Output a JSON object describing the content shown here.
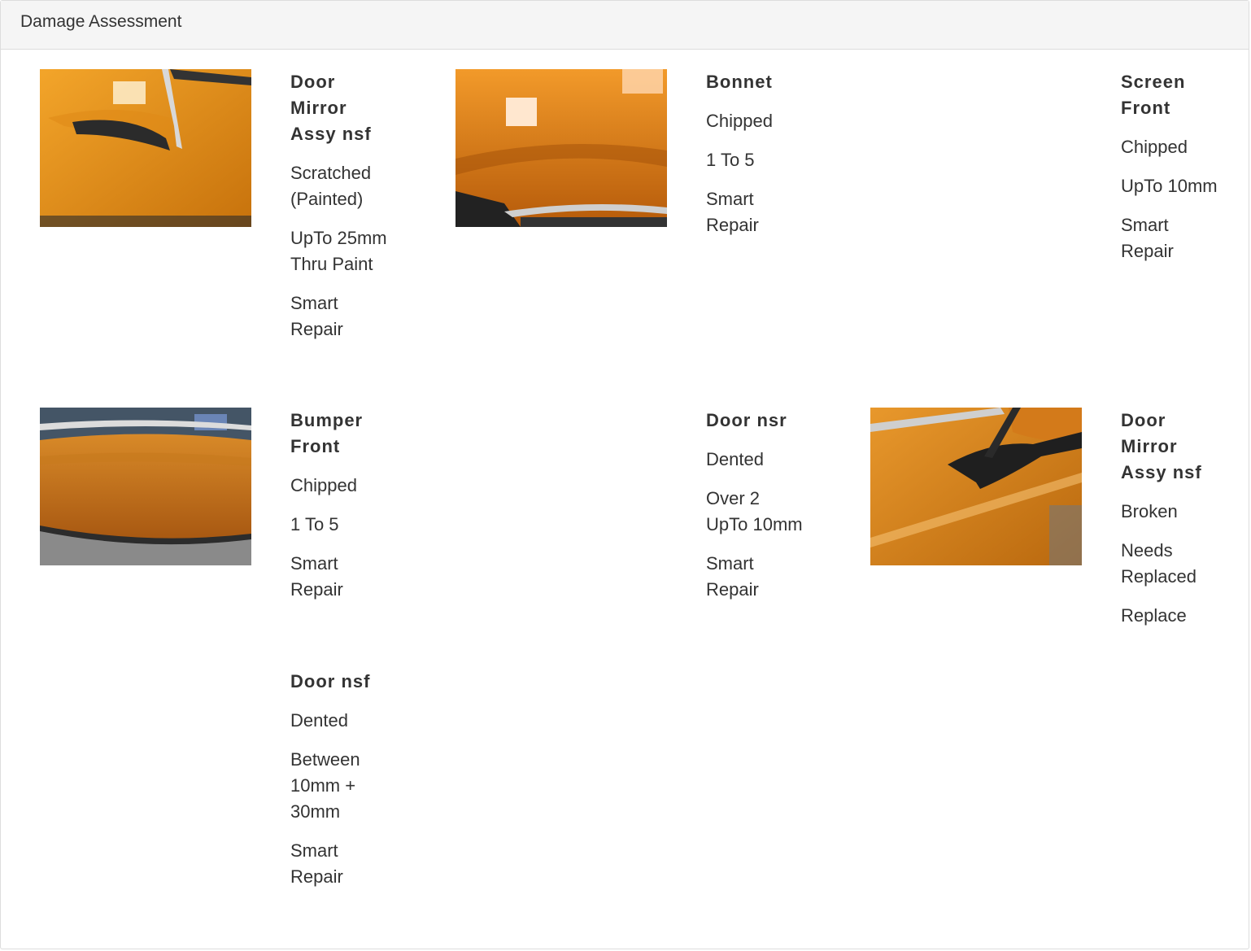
{
  "panel": {
    "title": "Damage Assessment"
  },
  "items": [
    {
      "part": "Door Mirror Assy nsf",
      "damage": "Scratched (Painted)",
      "extent": "UpTo 25mm Thru Paint",
      "action": "Smart Repair",
      "photo": "door-mirror-scratch"
    },
    {
      "part": "Bonnet",
      "damage": "Chipped",
      "extent": "1 To 5",
      "action": "Smart Repair",
      "photo": "bonnet"
    },
    {
      "part": "Screen Front",
      "damage": "Chipped",
      "extent": "UpTo 10mm",
      "action": "Smart Repair"
    },
    {
      "part": "Bumper Front",
      "damage": "Chipped",
      "extent": "1 To 5",
      "action": "Smart Repair",
      "photo": "bumper-front"
    },
    {
      "part": "Door nsr",
      "damage": "Dented",
      "extent": "Over 2 UpTo 10mm",
      "action": "Smart Repair"
    },
    {
      "part": "Door Mirror Assy nsf",
      "damage": "Broken",
      "extent": "Needs Replaced",
      "action": "Replace",
      "photo": "door-mirror-broken"
    },
    {
      "part": "Door nsf",
      "damage": "Dented",
      "extent": "Between 10mm + 30mm",
      "action": "Smart Repair"
    }
  ]
}
